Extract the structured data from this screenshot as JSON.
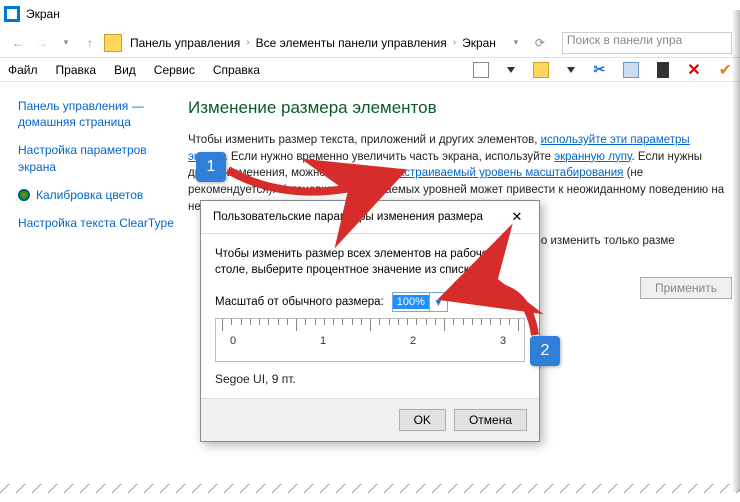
{
  "window": {
    "title": "Экран"
  },
  "nav": {
    "crumb1": "Панель управления",
    "crumb2": "Все элементы панели управления",
    "crumb3": "Экран",
    "search_placeholder": "Поиск в панели упра"
  },
  "menu": {
    "file": "Файл",
    "edit": "Правка",
    "view": "Вид",
    "service": "Сервис",
    "help": "Справка"
  },
  "sidebar": {
    "home": "Панель управления — домашняя страница",
    "params": "Настройка параметров экрана",
    "calibrate": "Калибровка цветов",
    "cleartype": "Настройка текста ClearType"
  },
  "main": {
    "heading": "Изменение размера элементов",
    "p1a": "Чтобы изменить размер текста, приложений и других элементов, ",
    "p1_link1": "используйте эти параметры экрана",
    "p1b": ". Если нужно временно увеличить часть экрана, используйте ",
    "p1_link2": "экранную лупу",
    "p1c": ". Если нужны другие изменения, можно ",
    "p1_link3": "установить настраиваемый уровень масштабирования",
    "p1d": " (не рекомендуется). Установка настраиваемых уровней может привести к неожиданному поведению на некоторых экрана",
    "sect2": " — можно изменить только разме",
    "apply": "Применить"
  },
  "dialog": {
    "title": "Пользовательские параметры изменения размера",
    "instr": "Чтобы изменить размер всех элементов на рабочем столе, выберите процентное значение из списка.",
    "scale_label": "Масштаб от обычного размера:",
    "scale_value": "100%",
    "ruler": {
      "t0": "0",
      "t1": "1",
      "t2": "2",
      "t3": "3"
    },
    "font_sample": "Segoe UI, 9 пт.",
    "ok": "OK",
    "cancel": "Отмена"
  },
  "badges": {
    "one": "1",
    "two": "2"
  }
}
